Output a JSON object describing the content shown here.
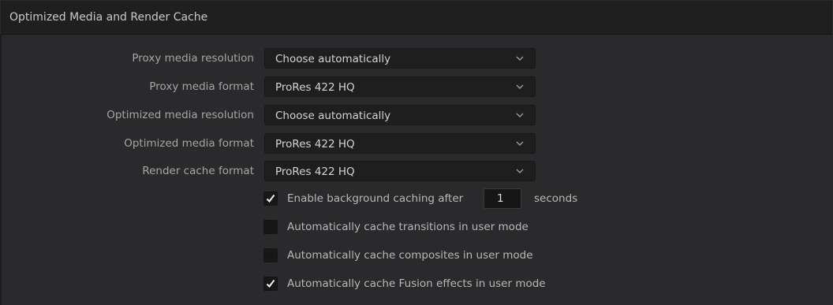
{
  "panel": {
    "title": "Optimized Media and Render Cache"
  },
  "settings": [
    {
      "label": "Proxy media resolution",
      "value": "Choose automatically"
    },
    {
      "label": "Proxy media format",
      "value": "ProRes 422 HQ"
    },
    {
      "label": "Optimized media resolution",
      "value": "Choose automatically"
    },
    {
      "label": "Optimized media format",
      "value": "ProRes 422 HQ"
    },
    {
      "label": "Render cache format",
      "value": "ProRes 422 HQ"
    }
  ],
  "background_caching": {
    "checked": true,
    "label": "Enable background caching after",
    "value": "1",
    "unit": "seconds"
  },
  "options": [
    {
      "label": "Automatically cache transitions in user mode",
      "checked": false
    },
    {
      "label": "Automatically cache composites in user mode",
      "checked": false
    },
    {
      "label": "Automatically cache Fusion effects in user mode",
      "checked": true
    }
  ],
  "icons": {
    "dropdown": "chevron-down-icon",
    "check": "checkmark-icon"
  },
  "colors": {
    "panel_bg": "#2a2a2c",
    "header_bg": "#1f1f20",
    "field_bg": "#1e1e1f",
    "label_text": "#a6a6a6"
  }
}
